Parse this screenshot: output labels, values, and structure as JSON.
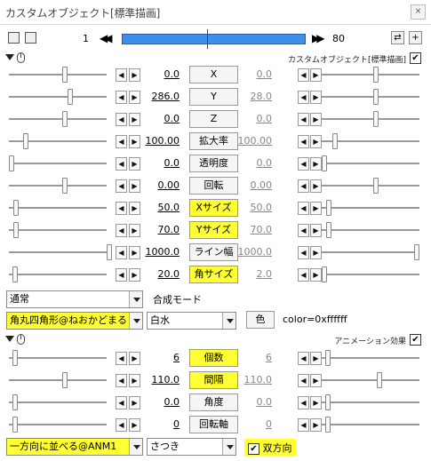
{
  "window": {
    "title": "カスタムオブジェクト[標準描画]",
    "close": "×"
  },
  "timeline": {
    "frame_start": "1",
    "frame_end": "80",
    "prev_label": "◀◀",
    "next_label": "▶▶",
    "icon_btn1": "⇄",
    "icon_btn2": "+"
  },
  "header1": {
    "label": "カスタムオブジェクト[標準描画]",
    "checked": "✔"
  },
  "params": [
    {
      "name": "X",
      "left_value": "0.0",
      "right_value": "0.0",
      "highlight": false
    },
    {
      "name": "Y",
      "left_value": "286.0",
      "right_value": "28.0",
      "highlight": false
    },
    {
      "name": "Z",
      "left_value": "0.0",
      "right_value": "0.0",
      "highlight": false
    },
    {
      "name": "拡大率",
      "left_value": "100.00",
      "right_value": "100.00",
      "highlight": false
    },
    {
      "name": "透明度",
      "left_value": "0.0",
      "right_value": "0.0",
      "highlight": false
    },
    {
      "name": "回転",
      "left_value": "0.00",
      "right_value": "0.00",
      "highlight": false
    },
    {
      "name": "Xサイズ",
      "left_value": "50.0",
      "right_value": "50.0",
      "highlight": true
    },
    {
      "name": "Yサイズ",
      "left_value": "70.0",
      "right_value": "70.0",
      "highlight": true
    },
    {
      "name": "ライン幅",
      "left_value": "1000.0",
      "right_value": "1000.0",
      "highlight": false
    },
    {
      "name": "角サイズ",
      "left_value": "20.0",
      "right_value": "2.0",
      "highlight": true
    }
  ],
  "blend": {
    "value": "通常",
    "label": "合成モード"
  },
  "object": {
    "script": "角丸四角形@ねおかどまるし",
    "preset": "白水",
    "color_btn": "色",
    "color_text": "color=0xffffff"
  },
  "header2": {
    "label": "アニメーション効果",
    "checked": "✔"
  },
  "anim_params": [
    {
      "name": "個数",
      "left_value": "6",
      "right_value": "6",
      "highlight": true
    },
    {
      "name": "間隔",
      "left_value": "110.0",
      "right_value": "110.0",
      "highlight": true
    },
    {
      "name": "角度",
      "left_value": "0.0",
      "right_value": "0.0",
      "highlight": false
    },
    {
      "name": "回転軸",
      "left_value": "0",
      "right_value": "0",
      "highlight": false
    }
  ],
  "anim": {
    "script": "一方向に並べる@ANM1",
    "preset": "さつき",
    "bidirectional_label": "双方向",
    "bidirectional_checked": "✔"
  }
}
